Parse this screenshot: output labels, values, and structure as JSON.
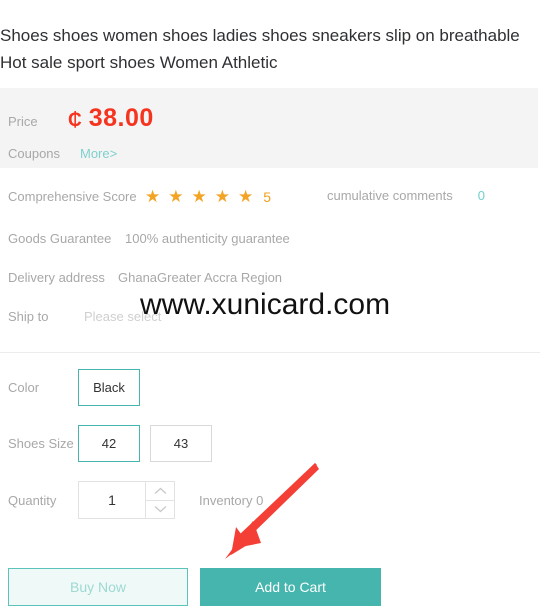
{
  "product": {
    "title_line1": "Shoes shoes women shoes ladies shoes sneakers slip on breathable",
    "title_line2": "Hot sale sport shoes Women Athletic"
  },
  "price": {
    "label": "Price",
    "currency_symbol": "₵",
    "amount": "38.00",
    "color": "#f5331e"
  },
  "coupons": {
    "label": "Coupons",
    "more_label": "More>"
  },
  "score": {
    "label": "Comprehensive Score",
    "stars": [
      "★",
      "★",
      "★",
      "★",
      "★"
    ],
    "value": "5",
    "star_color": "#f4a425"
  },
  "comments": {
    "label": "cumulative comments",
    "count": "0",
    "count_color": "#6fcfcb"
  },
  "guarantee": {
    "label": "Goods Guarantee",
    "value": "100% authenticity guarantee"
  },
  "delivery": {
    "label": "Delivery address",
    "value": "GhanaGreater Accra Region"
  },
  "ship_to": {
    "label": "Ship to",
    "placeholder": "Please select"
  },
  "watermark": {
    "text": "www.xunicard.com"
  },
  "options": {
    "color": {
      "label": "Color",
      "values": [
        {
          "label": "Black",
          "selected": true
        }
      ]
    },
    "size": {
      "label": "Shoes Size",
      "values": [
        {
          "label": "42",
          "selected": true
        },
        {
          "label": "43",
          "selected": false
        }
      ]
    }
  },
  "quantity": {
    "label": "Quantity",
    "value": "1",
    "increment_icon": "chevron-up-icon",
    "decrement_icon": "chevron-down-icon",
    "inventory_text": "Inventory 0"
  },
  "actions": {
    "buy_now": "Buy Now",
    "add_to_cart": "Add to Cart",
    "accent_color": "#45b5ad"
  },
  "annotation": {
    "arrow_color": "#f43f36"
  }
}
